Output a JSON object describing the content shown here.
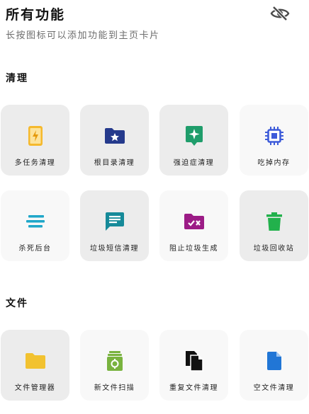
{
  "header": {
    "title": "所有功能",
    "subtitle": "长按图标可以添加功能到主页卡片",
    "visibility_icon": "eye-off-icon"
  },
  "sections": [
    {
      "title": "清理",
      "items": [
        {
          "label": "多任务清理",
          "icon": "phone-bolt-icon",
          "color": "#f5b92d",
          "bg": "gray"
        },
        {
          "label": "根目录清理",
          "icon": "folder-star-icon",
          "color": "#253a8c",
          "bg": "gray"
        },
        {
          "label": "强迫症清理",
          "icon": "sparkle-badge-icon",
          "color": "#1f9d6b",
          "bg": "gray"
        },
        {
          "label": "吃掉内存",
          "icon": "chip-icon",
          "color": "#3d5bd9",
          "bg": "light"
        },
        {
          "label": "杀死后台",
          "icon": "lines-icon",
          "color": "#1fa7c9",
          "bg": "light"
        },
        {
          "label": "垃圾短信清理",
          "icon": "message-icon",
          "color": "#168a99",
          "bg": "gray"
        },
        {
          "label": "阻止垃圾生成",
          "icon": "folder-x-icon",
          "color": "#9c1c86",
          "bg": "light"
        },
        {
          "label": "垃圾回收站",
          "icon": "trash-icon",
          "color": "#22b14c",
          "bg": "gray"
        }
      ]
    },
    {
      "title": "文件",
      "items": [
        {
          "label": "文件管理器",
          "icon": "folder-icon",
          "color": "#f2c230",
          "bg": "gray"
        },
        {
          "label": "新文件扫描",
          "icon": "file-scan-icon",
          "color": "#79b33f",
          "bg": "light"
        },
        {
          "label": "重复文件清理",
          "icon": "duplicate-file-icon",
          "color": "#111111",
          "bg": "light"
        },
        {
          "label": "空文件清理",
          "icon": "empty-file-icon",
          "color": "#2176d6",
          "bg": "light"
        }
      ]
    }
  ]
}
